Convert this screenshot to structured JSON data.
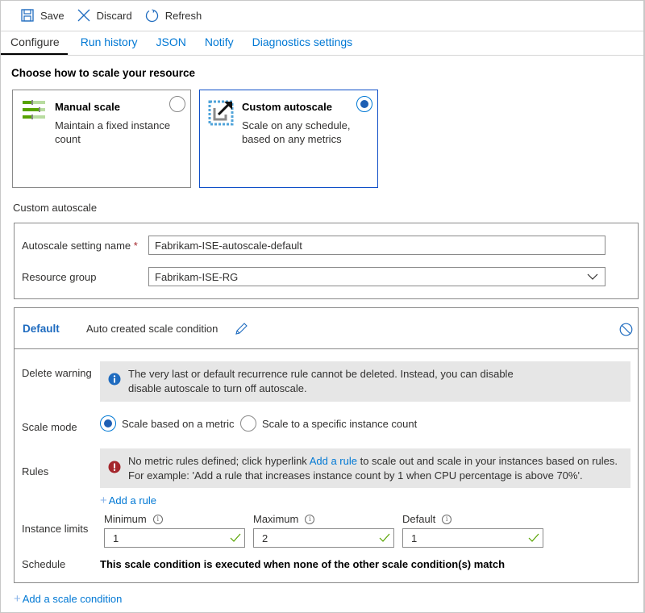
{
  "toolbar": {
    "save_label": "Save",
    "discard_label": "Discard",
    "refresh_label": "Refresh"
  },
  "tabs": [
    {
      "label": "Configure",
      "active": true
    },
    {
      "label": "Run history",
      "active": false
    },
    {
      "label": "JSON",
      "active": false
    },
    {
      "label": "Notify",
      "active": false
    },
    {
      "label": "Diagnostics settings",
      "active": false
    }
  ],
  "scale_choice": {
    "heading": "Choose how to scale your resource",
    "options": [
      {
        "title": "Manual scale",
        "description": "Maintain a fixed instance count",
        "selected": false,
        "icon": "manual-scale-sliders-icon"
      },
      {
        "title": "Custom autoscale",
        "description": "Scale on any schedule, based on any metrics",
        "selected": true,
        "icon": "custom-autoscale-icon"
      }
    ]
  },
  "custom_autoscale": {
    "section_label": "Custom autoscale",
    "setting_name_label": "Autoscale setting name",
    "required_marker": "*",
    "setting_name_value": "Fabrikam-ISE-autoscale-default",
    "resource_group_label": "Resource group",
    "resource_group_value": "Fabrikam-ISE-RG"
  },
  "condition": {
    "title": "Default",
    "name": "Auto created scale condition",
    "delete_warning_label": "Delete warning",
    "delete_warning_text_line1": "The very last or default recurrence rule cannot be deleted. Instead, you can disable",
    "delete_warning_text_line2": "disable autoscale to turn off autoscale.",
    "scale_mode_label": "Scale mode",
    "scale_mode_options": [
      {
        "label": "Scale based on a metric",
        "selected": true
      },
      {
        "label": "Scale to a specific instance count",
        "selected": false
      }
    ],
    "rules_label": "Rules",
    "rules_msg_pre": "No metric rules defined; click hyperlink ",
    "rules_msg_link": "Add a rule",
    "rules_msg_post": " to scale out and scale in your instances based on rules.",
    "rules_msg_line2": "For example: 'Add a rule that increases instance count by 1 when CPU percentage is above 70%'.",
    "add_rule_label": "Add a rule",
    "instance_limits_label": "Instance limits",
    "limits": [
      {
        "label": "Minimum",
        "value": "1"
      },
      {
        "label": "Maximum",
        "value": "2"
      },
      {
        "label": "Default",
        "value": "1"
      }
    ],
    "schedule_label": "Schedule",
    "schedule_text": "This scale condition is executed when none of the other scale condition(s) match"
  },
  "add_scale_condition_label": "Add a scale condition",
  "colors": {
    "accent": "#0078d4",
    "selected_border": "#0f4fc8",
    "error": "#a4262c",
    "success": "#57a300"
  }
}
